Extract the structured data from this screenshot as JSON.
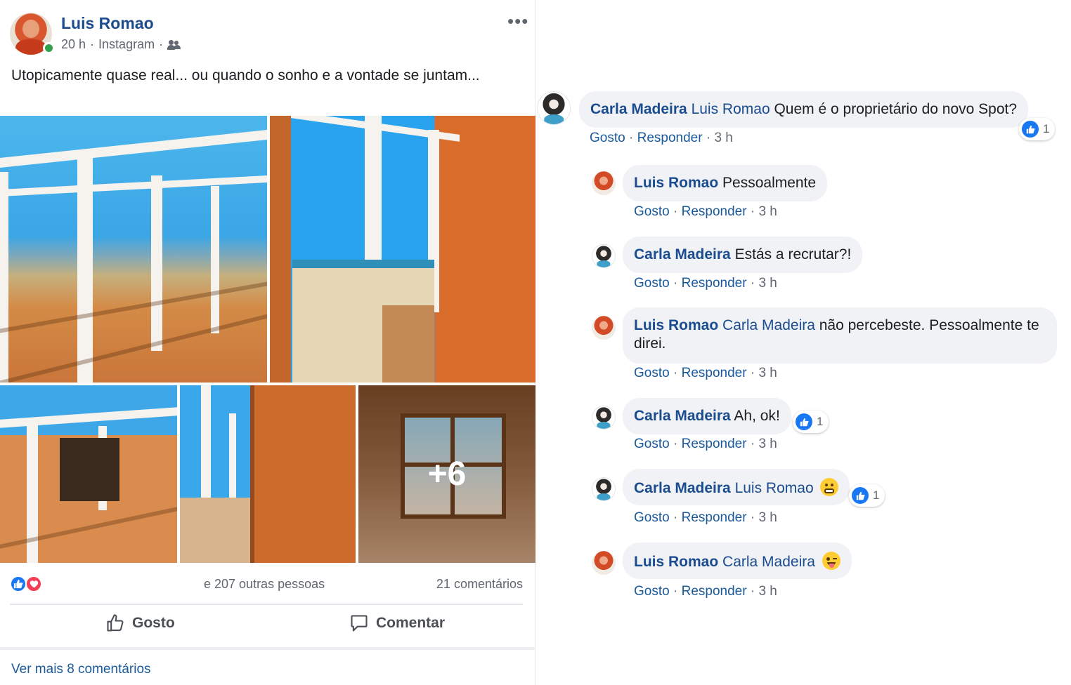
{
  "post": {
    "author": "Luis Romao",
    "time": "20 h",
    "source": "Instagram",
    "separator": "·",
    "text": "Utopicamente quase real... ou quando o sonho e a vontade se juntam...",
    "more_photos": "+6",
    "reactions_text": "e 207 outras pessoas",
    "comments_count": "21 comentários",
    "like_label": "Gosto",
    "comment_label": "Comentar",
    "see_more": "Ver mais 8 comentários"
  },
  "comment_meta": {
    "like": "Gosto",
    "reply": "Responder",
    "dot": "·"
  },
  "comments": [
    {
      "author": "Carla Madeira",
      "mention": "Luis Romao",
      "text": " Quem é o proprietário do novo Spot?",
      "time": "3 h",
      "likes": "1"
    },
    {
      "author": "Luis Romao",
      "mention": "",
      "text": "Pessoalmente",
      "time": "3 h",
      "likes": ""
    },
    {
      "author": "Carla Madeira",
      "mention": "",
      "text": "Estás a recrutar?!",
      "time": "3 h",
      "likes": ""
    },
    {
      "author": "Luis Romao",
      "mention": "Carla Madeira",
      "text": " não percebeste. Pessoalmente te direi.",
      "time": "3 h",
      "likes": ""
    },
    {
      "author": "Carla Madeira",
      "mention": "",
      "text": "Ah, ok!",
      "time": "3 h",
      "likes": "1"
    },
    {
      "author": "Carla Madeira",
      "mention": "Luis Romao",
      "text": "",
      "emoji": "grimacing-face",
      "time": "3 h",
      "likes": "1"
    },
    {
      "author": "Luis Romao",
      "mention": "Carla Madeira",
      "text": "",
      "emoji": "winking-tongue-face",
      "time": "3 h",
      "likes": ""
    }
  ],
  "colors": {
    "name_blue": "#1a4c8f",
    "link_blue": "#1a5a9c",
    "bubble_bg": "#f0f2f5",
    "like_blue": "#1877f2",
    "love_red": "#f33e58",
    "online_green": "#31a24c"
  }
}
